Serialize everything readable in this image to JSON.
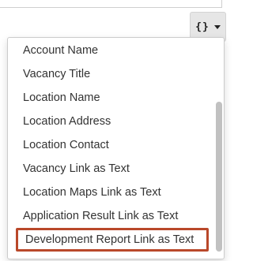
{
  "toolbar": {
    "insert_button_icon": "curly-braces-icon",
    "insert_button_glyph": "{}"
  },
  "menu": {
    "items": [
      {
        "label": "Account Name"
      },
      {
        "label": "Vacancy Title"
      },
      {
        "label": "Location Name"
      },
      {
        "label": "Location Address"
      },
      {
        "label": "Location Contact"
      },
      {
        "label": "Vacancy Link as Text"
      },
      {
        "label": "Location Maps Link as Text"
      },
      {
        "label": "Application Result Link as Text"
      },
      {
        "label": "Development Report Link as Text"
      }
    ],
    "selected_index": 8,
    "highlight_color": "#b9482a"
  }
}
